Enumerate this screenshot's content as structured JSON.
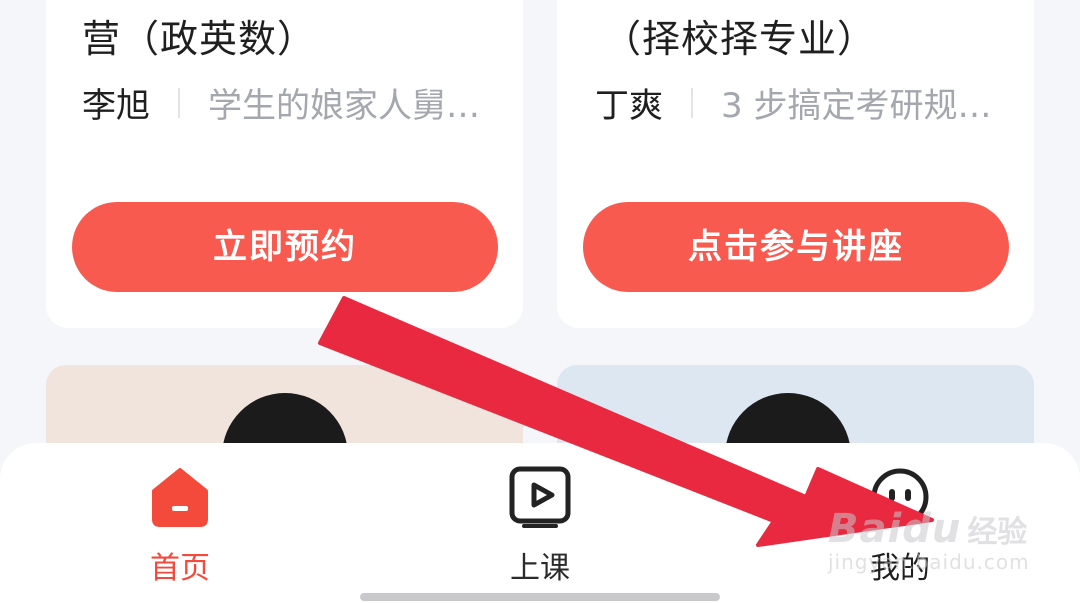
{
  "cards": [
    {
      "title": "营（政英数）",
      "speaker": "李旭",
      "desc": "学生的娘家人舅…",
      "cta_label": "立即预约"
    },
    {
      "title": "（择校择专业）",
      "speaker": "丁爽",
      "desc": "3 步搞定考研规…",
      "cta_label": "点击参与讲座"
    }
  ],
  "tabbar": {
    "active": "home",
    "tabs": [
      {
        "id": "home",
        "label": "首页",
        "icon": "home-icon"
      },
      {
        "id": "class",
        "label": "上课",
        "icon": "play-icon"
      },
      {
        "id": "mine",
        "label": "我的",
        "icon": "profile-face-icon"
      }
    ]
  },
  "colors": {
    "accent": "#f95a4f",
    "active_tab": "#f34a3c",
    "annotation_arrow": "#e8293f",
    "page_bg": "#f5f6fa"
  },
  "watermark": {
    "logo": "Baidu",
    "sub": "经验",
    "url": "jingyan.baidu.com"
  }
}
